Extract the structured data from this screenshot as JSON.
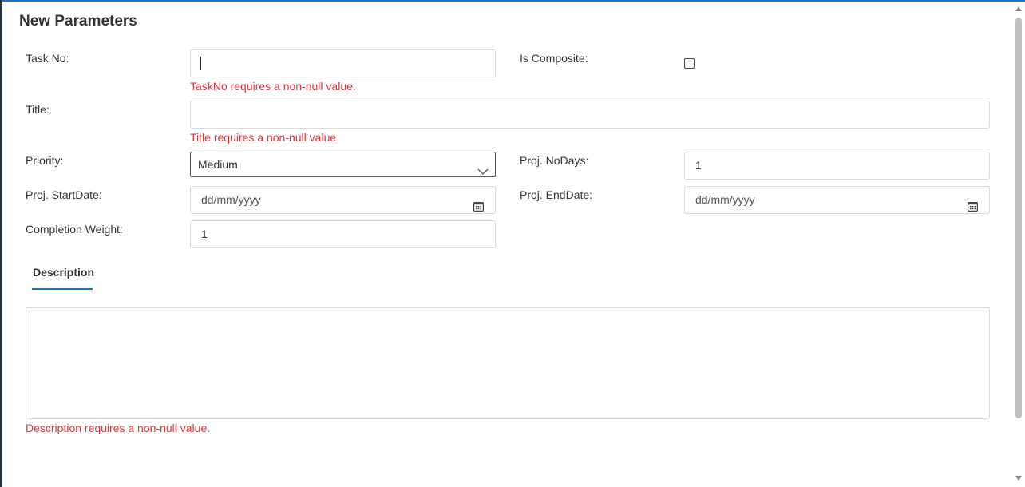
{
  "dialog": {
    "title": "New Parameters"
  },
  "fields": {
    "task_no": {
      "label": "Task No:",
      "value": "",
      "error": "TaskNo requires a non-null value."
    },
    "is_composite": {
      "label": "Is Composite:",
      "checked": false
    },
    "title": {
      "label": "Title:",
      "value": "",
      "error": "Title requires a non-null value."
    },
    "priority": {
      "label": "Priority:",
      "value": "Medium"
    },
    "proj_no_days": {
      "label": "Proj. NoDays:",
      "value": "1"
    },
    "proj_start_date": {
      "label": "Proj. StartDate:",
      "placeholder": "dd/mm/yyyy"
    },
    "proj_end_date": {
      "label": "Proj. EndDate:",
      "placeholder": "dd/mm/yyyy"
    },
    "completion_weight": {
      "label": "Completion Weight:",
      "value": "1"
    }
  },
  "tabs": [
    {
      "label": "Description",
      "active": true
    }
  ],
  "description": {
    "value": "",
    "error": "Description requires a non-null value."
  },
  "icons": {
    "priority_dropdown": "chevron-down-icon",
    "start_date": "calendar-icon",
    "end_date": "calendar-icon"
  },
  "colors": {
    "accent": "#1e73be",
    "error": "#d9363e",
    "text": "#333333",
    "border": "#d9d9d9"
  }
}
